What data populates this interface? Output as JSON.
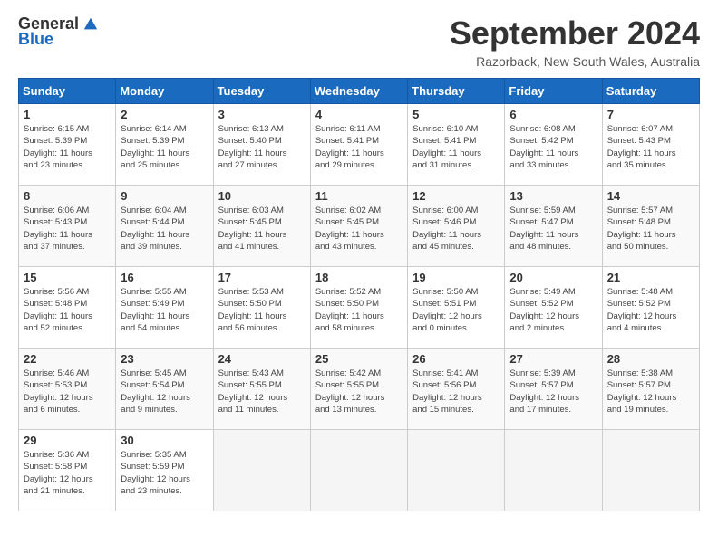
{
  "header": {
    "logo_general": "General",
    "logo_blue": "Blue",
    "month_title": "September 2024",
    "subtitle": "Razorback, New South Wales, Australia"
  },
  "calendar": {
    "days_of_week": [
      "Sunday",
      "Monday",
      "Tuesday",
      "Wednesday",
      "Thursday",
      "Friday",
      "Saturday"
    ],
    "weeks": [
      [
        {
          "day": "",
          "empty": true
        },
        {
          "day": "2",
          "sunrise": "6:14 AM",
          "sunset": "5:39 PM",
          "daylight": "11 hours and 25 minutes."
        },
        {
          "day": "3",
          "sunrise": "6:13 AM",
          "sunset": "5:40 PM",
          "daylight": "11 hours and 27 minutes."
        },
        {
          "day": "4",
          "sunrise": "6:11 AM",
          "sunset": "5:41 PM",
          "daylight": "11 hours and 29 minutes."
        },
        {
          "day": "5",
          "sunrise": "6:10 AM",
          "sunset": "5:41 PM",
          "daylight": "11 hours and 31 minutes."
        },
        {
          "day": "6",
          "sunrise": "6:08 AM",
          "sunset": "5:42 PM",
          "daylight": "11 hours and 33 minutes."
        },
        {
          "day": "7",
          "sunrise": "6:07 AM",
          "sunset": "5:43 PM",
          "daylight": "11 hours and 35 minutes."
        }
      ],
      [
        {
          "day": "1",
          "sunrise": "6:15 AM",
          "sunset": "5:39 PM",
          "daylight": "11 hours and 23 minutes."
        },
        {
          "day": "9",
          "sunrise": "6:04 AM",
          "sunset": "5:44 PM",
          "daylight": "11 hours and 39 minutes."
        },
        {
          "day": "10",
          "sunrise": "6:03 AM",
          "sunset": "5:45 PM",
          "daylight": "11 hours and 41 minutes."
        },
        {
          "day": "11",
          "sunrise": "6:02 AM",
          "sunset": "5:45 PM",
          "daylight": "11 hours and 43 minutes."
        },
        {
          "day": "12",
          "sunrise": "6:00 AM",
          "sunset": "5:46 PM",
          "daylight": "11 hours and 45 minutes."
        },
        {
          "day": "13",
          "sunrise": "5:59 AM",
          "sunset": "5:47 PM",
          "daylight": "11 hours and 48 minutes."
        },
        {
          "day": "14",
          "sunrise": "5:57 AM",
          "sunset": "5:48 PM",
          "daylight": "11 hours and 50 minutes."
        }
      ],
      [
        {
          "day": "8",
          "sunrise": "6:06 AM",
          "sunset": "5:43 PM",
          "daylight": "11 hours and 37 minutes."
        },
        {
          "day": "16",
          "sunrise": "5:55 AM",
          "sunset": "5:49 PM",
          "daylight": "11 hours and 54 minutes."
        },
        {
          "day": "17",
          "sunrise": "5:53 AM",
          "sunset": "5:50 PM",
          "daylight": "11 hours and 56 minutes."
        },
        {
          "day": "18",
          "sunrise": "5:52 AM",
          "sunset": "5:50 PM",
          "daylight": "11 hours and 58 minutes."
        },
        {
          "day": "19",
          "sunrise": "5:50 AM",
          "sunset": "5:51 PM",
          "daylight": "12 hours and 0 minutes."
        },
        {
          "day": "20",
          "sunrise": "5:49 AM",
          "sunset": "5:52 PM",
          "daylight": "12 hours and 2 minutes."
        },
        {
          "day": "21",
          "sunrise": "5:48 AM",
          "sunset": "5:52 PM",
          "daylight": "12 hours and 4 minutes."
        }
      ],
      [
        {
          "day": "15",
          "sunrise": "5:56 AM",
          "sunset": "5:48 PM",
          "daylight": "11 hours and 52 minutes."
        },
        {
          "day": "23",
          "sunrise": "5:45 AM",
          "sunset": "5:54 PM",
          "daylight": "12 hours and 9 minutes."
        },
        {
          "day": "24",
          "sunrise": "5:43 AM",
          "sunset": "5:55 PM",
          "daylight": "12 hours and 11 minutes."
        },
        {
          "day": "25",
          "sunrise": "5:42 AM",
          "sunset": "5:55 PM",
          "daylight": "12 hours and 13 minutes."
        },
        {
          "day": "26",
          "sunrise": "5:41 AM",
          "sunset": "5:56 PM",
          "daylight": "12 hours and 15 minutes."
        },
        {
          "day": "27",
          "sunrise": "5:39 AM",
          "sunset": "5:57 PM",
          "daylight": "12 hours and 17 minutes."
        },
        {
          "day": "28",
          "sunrise": "5:38 AM",
          "sunset": "5:57 PM",
          "daylight": "12 hours and 19 minutes."
        }
      ],
      [
        {
          "day": "22",
          "sunrise": "5:46 AM",
          "sunset": "5:53 PM",
          "daylight": "12 hours and 6 minutes."
        },
        {
          "day": "30",
          "sunrise": "5:35 AM",
          "sunset": "5:59 PM",
          "daylight": "12 hours and 23 minutes."
        },
        {
          "day": "",
          "empty": true
        },
        {
          "day": "",
          "empty": true
        },
        {
          "day": "",
          "empty": true
        },
        {
          "day": "",
          "empty": true
        },
        {
          "day": "",
          "empty": true
        }
      ],
      [
        {
          "day": "29",
          "sunrise": "5:36 AM",
          "sunset": "5:58 PM",
          "daylight": "12 hours and 21 minutes."
        },
        {
          "day": "",
          "empty": true
        },
        {
          "day": "",
          "empty": true
        },
        {
          "day": "",
          "empty": true
        },
        {
          "day": "",
          "empty": true
        },
        {
          "day": "",
          "empty": true
        },
        {
          "day": "",
          "empty": true
        }
      ]
    ]
  }
}
